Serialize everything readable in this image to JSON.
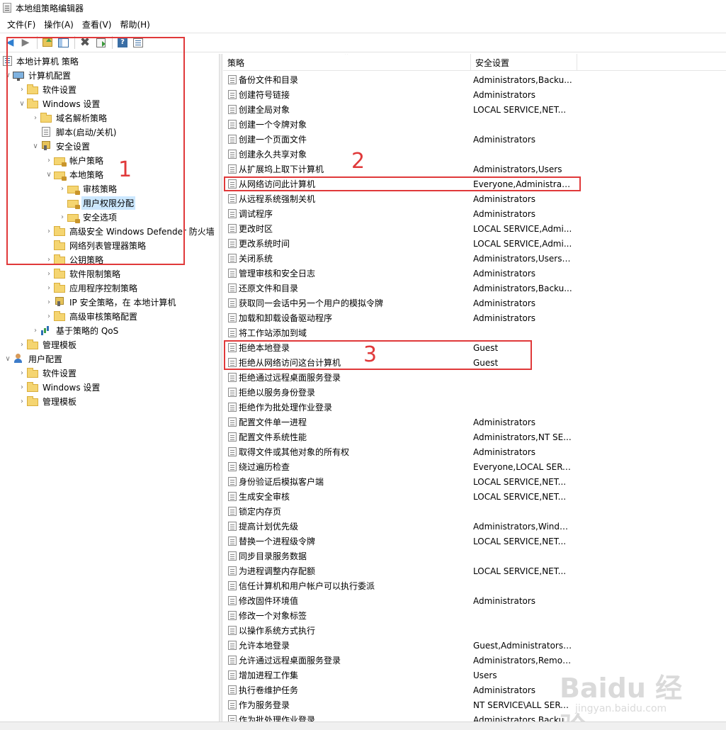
{
  "window": {
    "title": "本地组策略编辑器"
  },
  "menu": [
    "文件(F)",
    "操作(A)",
    "查看(V)",
    "帮助(H)"
  ],
  "toolbar": {
    "buttons": [
      "back-arrow-icon",
      "forward-arrow-icon",
      "up-folder-icon",
      "show-hide-tree-icon",
      "delete-icon",
      "export-list-icon",
      "help-icon",
      "properties-icon"
    ]
  },
  "tree": [
    {
      "label": "本地计算机 策略",
      "icon": "policy"
    },
    {
      "label": "计算机配置",
      "icon": "pc"
    },
    {
      "label": "软件设置",
      "icon": "folder"
    },
    {
      "label": "Windows 设置",
      "icon": "folder"
    },
    {
      "label": "域名解析策略",
      "icon": "folder"
    },
    {
      "label": "脚本(启动/关机)",
      "icon": "doc"
    },
    {
      "label": "安全设置",
      "icon": "shield"
    },
    {
      "label": "帐户策略",
      "icon": "lockfolder"
    },
    {
      "label": "本地策略",
      "icon": "lockfolder"
    },
    {
      "label": "审核策略",
      "icon": "lockfolder"
    },
    {
      "label": "用户权限分配",
      "icon": "lockfolder"
    },
    {
      "label": "安全选项",
      "icon": "lockfolder"
    },
    {
      "label": "高级安全 Windows Defender 防火墙",
      "icon": "folder"
    },
    {
      "label": "网络列表管理器策略",
      "icon": "folder"
    },
    {
      "label": "公钥策略",
      "icon": "folder"
    },
    {
      "label": "软件限制策略",
      "icon": "folder"
    },
    {
      "label": "应用程序控制策略",
      "icon": "folder"
    },
    {
      "label": "IP 安全策略，在 本地计算机",
      "icon": "shield"
    },
    {
      "label": "高级审核策略配置",
      "icon": "folder"
    },
    {
      "label": "基于策略的 QoS",
      "icon": "chart"
    },
    {
      "label": "管理模板",
      "icon": "folder"
    },
    {
      "label": "用户配置",
      "icon": "user"
    },
    {
      "label": "软件设置",
      "icon": "folder"
    },
    {
      "label": "Windows 设置",
      "icon": "folder"
    },
    {
      "label": "管理模板",
      "icon": "folder"
    }
  ],
  "list": {
    "columns": [
      "策略",
      "安全设置"
    ],
    "rows": [
      {
        "policy": "备份文件和目录",
        "setting": "Administrators,Backu..."
      },
      {
        "policy": "创建符号链接",
        "setting": "Administrators"
      },
      {
        "policy": "创建全局对象",
        "setting": "LOCAL SERVICE,NET..."
      },
      {
        "policy": "创建一个令牌对象",
        "setting": ""
      },
      {
        "policy": "创建一个页面文件",
        "setting": "Administrators"
      },
      {
        "policy": "创建永久共享对象",
        "setting": ""
      },
      {
        "policy": "从扩展坞上取下计算机",
        "setting": "Administrators,Users"
      },
      {
        "policy": "从网络访问此计算机",
        "setting": "Everyone,Administrat..."
      },
      {
        "policy": "从远程系统强制关机",
        "setting": "Administrators"
      },
      {
        "policy": "调试程序",
        "setting": "Administrators"
      },
      {
        "policy": "更改时区",
        "setting": "LOCAL SERVICE,Admi..."
      },
      {
        "policy": "更改系统时间",
        "setting": "LOCAL SERVICE,Admi..."
      },
      {
        "policy": "关闭系统",
        "setting": "Administrators,Users,..."
      },
      {
        "policy": "管理审核和安全日志",
        "setting": "Administrators"
      },
      {
        "policy": "还原文件和目录",
        "setting": "Administrators,Backu..."
      },
      {
        "policy": "获取同一会话中另一个用户的模拟令牌",
        "setting": "Administrators"
      },
      {
        "policy": "加载和卸载设备驱动程序",
        "setting": "Administrators"
      },
      {
        "policy": "将工作站添加到域",
        "setting": ""
      },
      {
        "policy": "拒绝本地登录",
        "setting": "Guest"
      },
      {
        "policy": "拒绝从网络访问这台计算机",
        "setting": "Guest"
      },
      {
        "policy": "拒绝通过远程桌面服务登录",
        "setting": ""
      },
      {
        "policy": "拒绝以服务身份登录",
        "setting": ""
      },
      {
        "policy": "拒绝作为批处理作业登录",
        "setting": ""
      },
      {
        "policy": "配置文件单一进程",
        "setting": "Administrators"
      },
      {
        "policy": "配置文件系统性能",
        "setting": "Administrators,NT SE..."
      },
      {
        "policy": "取得文件或其他对象的所有权",
        "setting": "Administrators"
      },
      {
        "policy": "绕过遍历检查",
        "setting": "Everyone,LOCAL SERV..."
      },
      {
        "policy": "身份验证后模拟客户端",
        "setting": "LOCAL SERVICE,NET..."
      },
      {
        "policy": "生成安全审核",
        "setting": "LOCAL SERVICE,NET..."
      },
      {
        "policy": "锁定内存页",
        "setting": ""
      },
      {
        "policy": "提高计划优先级",
        "setting": "Administrators,Windo..."
      },
      {
        "policy": "替换一个进程级令牌",
        "setting": "LOCAL SERVICE,NET..."
      },
      {
        "policy": "同步目录服务数据",
        "setting": ""
      },
      {
        "policy": "为进程调整内存配额",
        "setting": "LOCAL SERVICE,NET..."
      },
      {
        "policy": "信任计算机和用户帐户可以执行委派",
        "setting": ""
      },
      {
        "policy": "修改固件环境值",
        "setting": "Administrators"
      },
      {
        "policy": "修改一个对象标签",
        "setting": ""
      },
      {
        "policy": "以操作系统方式执行",
        "setting": ""
      },
      {
        "policy": "允许本地登录",
        "setting": "Guest,Administrators,..."
      },
      {
        "policy": "允许通过远程桌面服务登录",
        "setting": "Administrators,Remot..."
      },
      {
        "policy": "增加进程工作集",
        "setting": "Users"
      },
      {
        "policy": "执行卷维护任务",
        "setting": "Administrators"
      },
      {
        "policy": "作为服务登录",
        "setting": "NT SERVICE\\ALL SERV..."
      },
      {
        "policy": "作为批处理作业登录",
        "setting": "Administrators,Backu..."
      }
    ]
  },
  "annotations": [
    "1",
    "2",
    "3"
  ],
  "watermark": {
    "main": "Baidu 经验",
    "sub": "jingyan.baidu.com"
  },
  "colors": {
    "annotation": "#e0393a",
    "selection": "#cce8ff"
  }
}
